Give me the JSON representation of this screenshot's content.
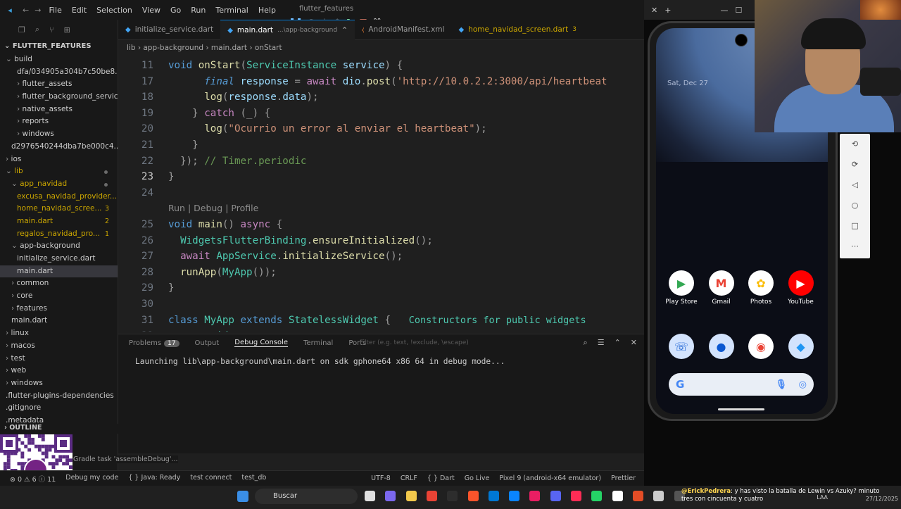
{
  "titlebar": {
    "menu": [
      "File",
      "Edit",
      "Selection",
      "View",
      "Go",
      "Run",
      "Terminal",
      "Help"
    ],
    "window_title": "flutter_features"
  },
  "tabs": [
    {
      "label": "initialize_service.dart",
      "extra": ""
    },
    {
      "label": "main.dart",
      "extra": "...\\app-background"
    },
    {
      "label": "AndroidManifest.xml",
      "extra": ""
    },
    {
      "label": "home_navidad_screen.dart",
      "extra": "3"
    }
  ],
  "breadcrumb": [
    "lib",
    "app-background",
    "main.dart",
    "onStart"
  ],
  "explorer": {
    "section": "FLUTTER_FEATURES",
    "items": [
      {
        "label": "build",
        "indent": 1,
        "kind": "folder-open",
        "badge": "",
        "color": ""
      },
      {
        "label": "dfa/034905a304b7c50be8...",
        "indent": 3,
        "kind": "file",
        "badge": "",
        "color": ""
      },
      {
        "label": "flutter_assets",
        "indent": 3,
        "kind": "folder",
        "badge": "",
        "color": ""
      },
      {
        "label": "flutter_background_service...",
        "indent": 3,
        "kind": "folder",
        "badge": "",
        "color": ""
      },
      {
        "label": "native_assets",
        "indent": 3,
        "kind": "folder",
        "badge": "",
        "color": ""
      },
      {
        "label": "reports",
        "indent": 3,
        "kind": "folder",
        "badge": "",
        "color": ""
      },
      {
        "label": "windows",
        "indent": 3,
        "kind": "folder",
        "badge": "",
        "color": ""
      },
      {
        "label": "d2976540244dba7be000c4...",
        "indent": 2,
        "kind": "file",
        "badge": "",
        "color": ""
      },
      {
        "label": "ios",
        "indent": 1,
        "kind": "folder",
        "badge": "",
        "color": ""
      },
      {
        "label": "lib",
        "indent": 1,
        "kind": "folder-open",
        "badge": "",
        "color": "warn",
        "dot": true
      },
      {
        "label": "app_navidad",
        "indent": 2,
        "kind": "folder-open",
        "badge": "",
        "color": "warn",
        "dot": true
      },
      {
        "label": "excusa_navidad_provider...",
        "indent": 3,
        "kind": "file",
        "badge": "",
        "color": "warn"
      },
      {
        "label": "home_navidad_scree...",
        "indent": 3,
        "kind": "file",
        "badge": "3",
        "color": "warn"
      },
      {
        "label": "main.dart",
        "indent": 3,
        "kind": "file",
        "badge": "2",
        "color": "warn"
      },
      {
        "label": "regalos_navidad_pro...",
        "indent": 3,
        "kind": "file",
        "badge": "1",
        "color": "warn"
      },
      {
        "label": "app-background",
        "indent": 2,
        "kind": "folder-open",
        "badge": "",
        "color": ""
      },
      {
        "label": "initialize_service.dart",
        "indent": 3,
        "kind": "file",
        "badge": "",
        "color": ""
      },
      {
        "label": "main.dart",
        "indent": 3,
        "kind": "file",
        "badge": "",
        "color": "",
        "selected": true
      },
      {
        "label": "common",
        "indent": 2,
        "kind": "folder",
        "badge": "",
        "color": ""
      },
      {
        "label": "core",
        "indent": 2,
        "kind": "folder",
        "badge": "",
        "color": ""
      },
      {
        "label": "features",
        "indent": 2,
        "kind": "folder",
        "badge": "",
        "color": ""
      },
      {
        "label": "main.dart",
        "indent": 2,
        "kind": "file",
        "badge": "",
        "color": ""
      },
      {
        "label": "linux",
        "indent": 1,
        "kind": "folder",
        "badge": "",
        "color": ""
      },
      {
        "label": "macos",
        "indent": 1,
        "kind": "folder",
        "badge": "",
        "color": ""
      },
      {
        "label": "test",
        "indent": 1,
        "kind": "folder",
        "badge": "",
        "color": ""
      },
      {
        "label": "web",
        "indent": 1,
        "kind": "folder",
        "badge": "",
        "color": ""
      },
      {
        "label": "windows",
        "indent": 1,
        "kind": "folder",
        "badge": "",
        "color": ""
      },
      {
        "label": ".flutter-plugins-dependencies",
        "indent": 1,
        "kind": "file",
        "badge": "",
        "color": ""
      },
      {
        "label": ".gitignore",
        "indent": 1,
        "kind": "file",
        "badge": "",
        "color": ""
      },
      {
        "label": ".metadata",
        "indent": 1,
        "kind": "file",
        "badge": "",
        "color": ""
      }
    ],
    "outline": "OUTLINE"
  },
  "editor": {
    "lines": [
      {
        "n": "11",
        "tokens": [
          [
            "kwb",
            "void "
          ],
          [
            "fn",
            "onStart"
          ],
          [
            "gr",
            "("
          ],
          [
            "ty",
            "ServiceInstance "
          ],
          [
            "var",
            "service"
          ],
          [
            "gr",
            ") {"
          ]
        ]
      },
      {
        "n": "17",
        "tokens": [
          [
            "gr",
            "      "
          ],
          [
            "kwb it",
            "final "
          ],
          [
            "var",
            "response "
          ],
          [
            "gr",
            "= "
          ],
          [
            "kw",
            "await "
          ],
          [
            "var",
            "dio"
          ],
          [
            "gr",
            "."
          ],
          [
            "fn",
            "post"
          ],
          [
            "gr",
            "("
          ],
          [
            "str",
            "'http://10.0.2.2:3000/api/heartbeat"
          ]
        ]
      },
      {
        "n": "18",
        "tokens": [
          [
            "gr",
            "      "
          ],
          [
            "fn",
            "log"
          ],
          [
            "gr",
            "("
          ],
          [
            "var",
            "response"
          ],
          [
            "gr",
            "."
          ],
          [
            "var",
            "data"
          ],
          [
            "gr",
            ");"
          ]
        ]
      },
      {
        "n": "19",
        "tokens": [
          [
            "gr",
            "    } "
          ],
          [
            "kw",
            "catch "
          ],
          [
            "gr",
            "(_) {"
          ]
        ]
      },
      {
        "n": "20",
        "tokens": [
          [
            "gr",
            "      "
          ],
          [
            "fn",
            "log"
          ],
          [
            "gr",
            "("
          ],
          [
            "str",
            "\"Ocurrio un error al enviar el heartbeat\""
          ],
          [
            "gr",
            ");"
          ]
        ]
      },
      {
        "n": "21",
        "tokens": [
          [
            "gr",
            "    }"
          ]
        ]
      },
      {
        "n": "22",
        "tokens": [
          [
            "gr",
            "  }); "
          ],
          [
            "cm",
            "// Timer.periodic"
          ]
        ]
      },
      {
        "n": "23",
        "tokens": [
          [
            "gr",
            "}"
          ]
        ],
        "current": true
      },
      {
        "n": "24",
        "tokens": []
      },
      {
        "n": "",
        "codelens": "Run | Debug | Profile"
      },
      {
        "n": "25",
        "tokens": [
          [
            "kwb",
            "void "
          ],
          [
            "fn",
            "main"
          ],
          [
            "gr",
            "() "
          ],
          [
            "kw",
            "async "
          ],
          [
            "gr",
            "{"
          ]
        ]
      },
      {
        "n": "26",
        "tokens": [
          [
            "gr",
            "  "
          ],
          [
            "ty",
            "WidgetsFlutterBinding"
          ],
          [
            "gr",
            "."
          ],
          [
            "fn",
            "ensureInitialized"
          ],
          [
            "gr",
            "();"
          ]
        ]
      },
      {
        "n": "27",
        "tokens": [
          [
            "gr",
            "  "
          ],
          [
            "kw",
            "await "
          ],
          [
            "ty",
            "AppService"
          ],
          [
            "gr",
            "."
          ],
          [
            "fn",
            "initializeService"
          ],
          [
            "gr",
            "();"
          ]
        ]
      },
      {
        "n": "28",
        "tokens": [
          [
            "gr",
            "  "
          ],
          [
            "fn",
            "runApp"
          ],
          [
            "gr",
            "("
          ],
          [
            "ty",
            "MyApp"
          ],
          [
            "gr",
            "());"
          ]
        ]
      },
      {
        "n": "29",
        "tokens": [
          [
            "gr",
            "}"
          ]
        ]
      },
      {
        "n": "30",
        "tokens": []
      },
      {
        "n": "31",
        "tokens": [
          [
            "kwb",
            "class "
          ],
          [
            "ty",
            "MyApp "
          ],
          [
            "kwb",
            "extends "
          ],
          [
            "ty",
            "StatelessWidget "
          ],
          [
            "gr",
            "{   "
          ],
          [
            "inlay",
            "Constructors for public widgets"
          ]
        ]
      },
      {
        "n": "32",
        "tokens": [
          [
            "gr",
            "  "
          ],
          [
            "ty",
            "@override"
          ]
        ]
      }
    ]
  },
  "panel": {
    "tabs": [
      {
        "label": "Problems",
        "badge": "17"
      },
      {
        "label": "Output",
        "badge": ""
      },
      {
        "label": "Debug Console",
        "badge": "",
        "active": true
      },
      {
        "label": "Terminal",
        "badge": ""
      },
      {
        "label": "Ports",
        "badge": ""
      }
    ],
    "filter_placeholder": "Filter (e.g. text, !exclude, \\escape)",
    "output": "Launching lib\\app-background\\main.dart on sdk gphone64 x86 64 in debug mode..."
  },
  "gradle": "Gradle task 'assembleDebug'...",
  "statusbar": {
    "left": [
      "⊗ 0 ⚠ 6 ⓘ 11",
      "Debug my code",
      "{ } Java: Ready",
      "test connect",
      "test_db"
    ],
    "right": [
      "UTF-8",
      "CRLF",
      "{ } Dart",
      "Go Live",
      "Pixel 9 (android-x64 emulator)",
      "Prettier"
    ]
  },
  "taskbar": {
    "search": "Buscar",
    "chat_user": "@ErickPedrera",
    "chat_msg": ": y has visto la batalla de Lewin vs Azuky? minuto tres con cincuenta y cuatro",
    "lang": "LAA",
    "clock_date": "27/12/2025"
  },
  "phone": {
    "date": "Sat, Dec 27",
    "apps_row1": [
      {
        "label": "Play Store",
        "color": "#ffffff",
        "glyph": "▶",
        "fg": "#34a853"
      },
      {
        "label": "Gmail",
        "color": "#ffffff",
        "glyph": "M",
        "fg": "#ea4335"
      },
      {
        "label": "Photos",
        "color": "#ffffff",
        "glyph": "✿",
        "fg": "#fbbc04"
      },
      {
        "label": "YouTube",
        "color": "#ff0000",
        "glyph": "▶",
        "fg": "#ffffff"
      }
    ],
    "apps_row2": [
      {
        "color": "#d3e3fd",
        "glyph": "☏",
        "fg": "#0b57d0"
      },
      {
        "color": "#d3e3fd",
        "glyph": "●",
        "fg": "#0b57d0"
      },
      {
        "color": "#ffffff",
        "glyph": "◉",
        "fg": "#ea4335"
      },
      {
        "color": "#d3e3fd",
        "glyph": "◆",
        "fg": "#2196f3"
      }
    ]
  }
}
